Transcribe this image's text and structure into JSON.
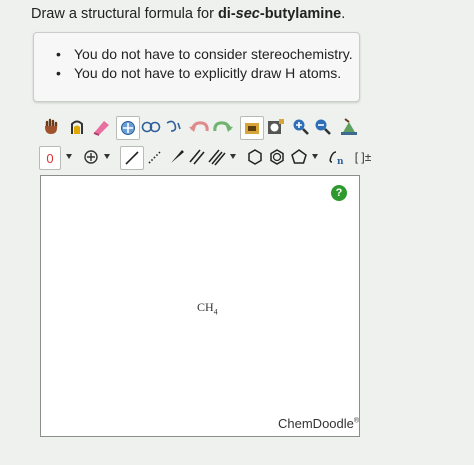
{
  "question": {
    "prefix": "Draw a structural formula for ",
    "compound_prefix": "di-",
    "compound_italic": "sec",
    "compound_suffix": "-butylamine",
    "end": "."
  },
  "notes": [
    "You do not have to consider stereochemistry.",
    "You do not have to explicitly draw H atoms."
  ],
  "toolbar": {
    "charge_label": "0",
    "bracket_label": "[ ]±"
  },
  "canvas": {
    "placeholder_formula_main": "CH",
    "placeholder_formula_sub": "4",
    "help_label": "?",
    "brand": "ChemDoodle",
    "brand_mark": "®"
  }
}
